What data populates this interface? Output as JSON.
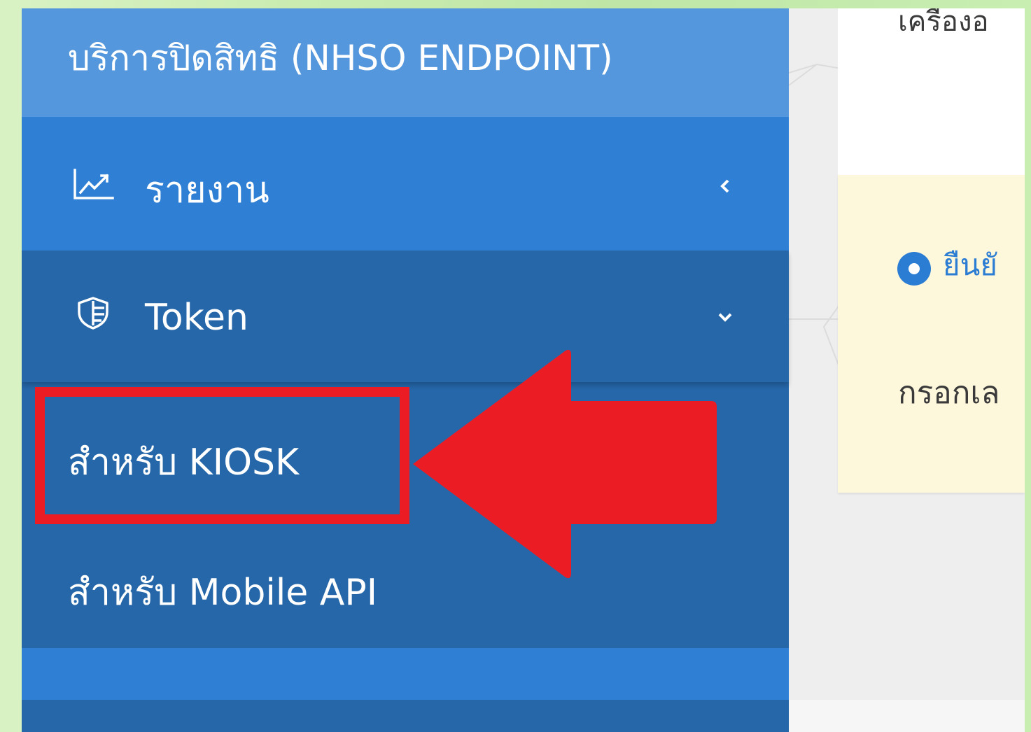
{
  "sidebar": {
    "header_title": "บริการปิดสิทธิ (NHSO ENDPOINT)",
    "items": [
      {
        "label": "รายงาน",
        "icon": "line-chart-icon",
        "expanded": false,
        "chevron": "chevron-left-icon"
      },
      {
        "label": "Token",
        "icon": "shield-icon",
        "expanded": true,
        "chevron": "chevron-down-icon",
        "children": [
          {
            "label": "สำหรับ KIOSK",
            "highlighted": true
          },
          {
            "label": "สำหรับ Mobile API"
          }
        ]
      }
    ]
  },
  "content": {
    "top_text": "เครื่องอ",
    "radio_label": "ยืนยั",
    "prompt_text": "กรอกเล"
  },
  "annotation": {
    "type": "red-arrow-pointing-left",
    "color": "#ec1c24"
  },
  "colors": {
    "sidebar_dark": "#2567a9",
    "sidebar_active": "#2f7fd4",
    "sidebar_header": "#5497dc",
    "radio": "#2b7cd3",
    "info_panel": "#fdf7dc",
    "annotation_red": "#ec1c24"
  }
}
